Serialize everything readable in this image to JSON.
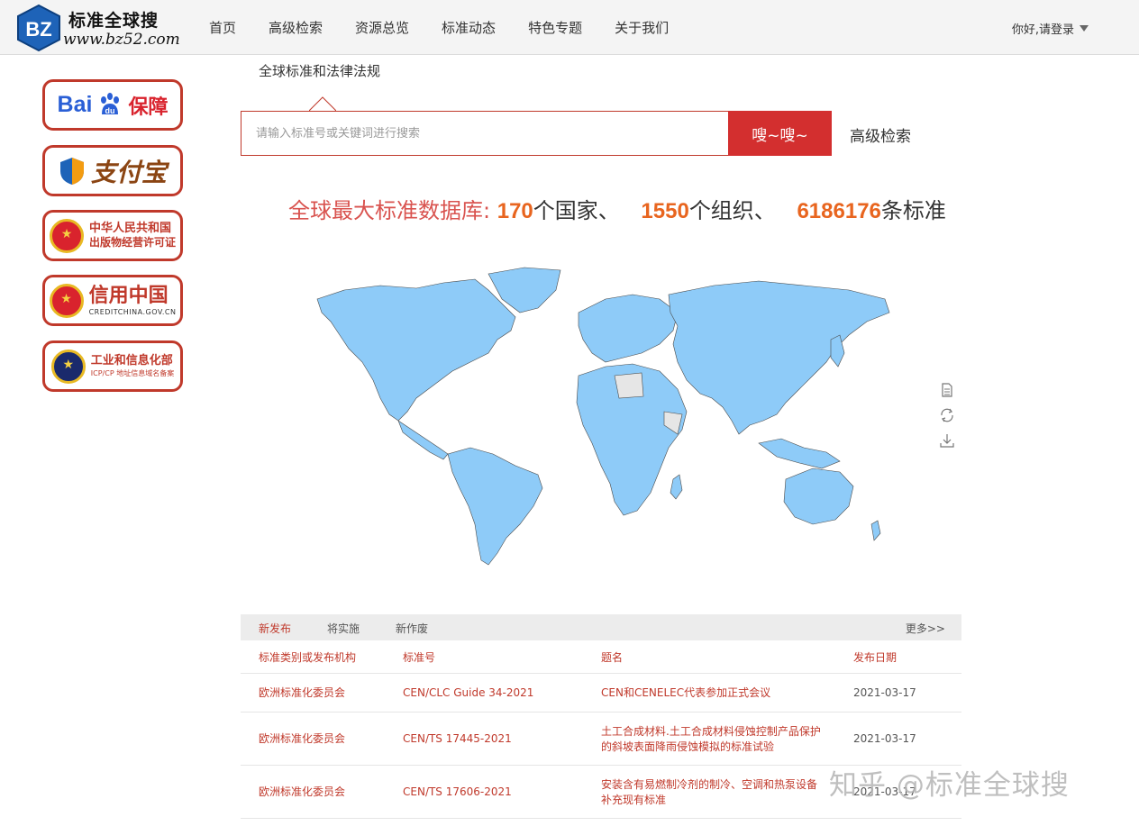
{
  "header": {
    "logo_mark": "BZ",
    "logo_title": "标准全球搜",
    "logo_url": "www.bz52.com",
    "nav": [
      "首页",
      "高级检索",
      "资源总览",
      "标准动态",
      "特色专题",
      "关于我们"
    ],
    "user_menu": "你好,请登录"
  },
  "badges": {
    "baidu": {
      "text": "Bai",
      "du": "du",
      "label": "保障"
    },
    "alipay": {
      "label": "支付宝"
    },
    "publishing": {
      "line1": "中华人民共和国",
      "line2": "出版物经营许可证"
    },
    "creditchina": {
      "line1": "信用中国",
      "line2": "CREDITCHINA.GOV.CN"
    },
    "miit": {
      "line1": "工业和信息化部",
      "line2": "ICP/CP 地址信息域名备案"
    }
  },
  "search": {
    "tab_label": "全球标准和法律法规",
    "placeholder": "请输入标准号或关键词进行搜索",
    "button_label": "嗖~嗖~",
    "advanced_label": "高级检索"
  },
  "headline": {
    "prefix": "全球最大标准数据库:",
    "countries": "170",
    "countries_unit": "个国家、",
    "orgs": "1550",
    "orgs_unit": "个组织、",
    "standards": "6186176",
    "standards_unit": "条标准"
  },
  "map": {
    "land_color": "#8ecbf8",
    "nodata_color": "#e6e6e6",
    "tools": [
      "data-view-icon",
      "refresh-icon",
      "download-icon"
    ]
  },
  "table": {
    "tabs": [
      "新发布",
      "将实施",
      "新作废"
    ],
    "more": "更多>>",
    "headers": [
      "标准类别或发布机构",
      "标准号",
      "题名",
      "发布日期"
    ],
    "rows": [
      {
        "org": "欧洲标准化委员会",
        "code": "CEN/CLC Guide 34-2021",
        "title": "CEN和CENELEC代表参加正式会议",
        "date": "2021-03-17"
      },
      {
        "org": "欧洲标准化委员会",
        "code": "CEN/TS 17445-2021",
        "title": "土工合成材料.土工合成材料侵蚀控制产品保护的斜坡表面降雨侵蚀模拟的标准试验",
        "date": "2021-03-17"
      },
      {
        "org": "欧洲标准化委员会",
        "code": "CEN/TS 17606-2021",
        "title": "安装含有易燃制冷剂的制冷、空调和热泵设备补充现有标准",
        "date": "2021-03-17"
      }
    ]
  },
  "watermark": "知乎 @标准全球搜"
}
